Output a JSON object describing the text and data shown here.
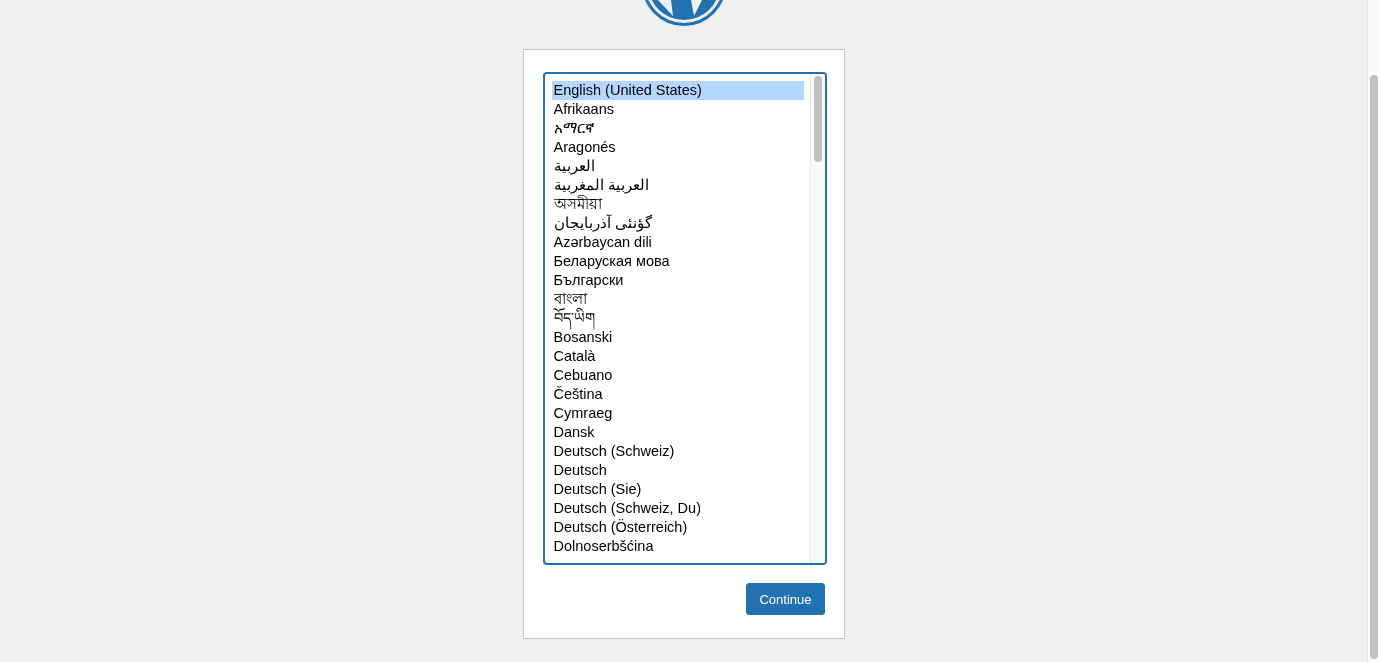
{
  "languages": [
    {
      "label": "English (United States)",
      "selected": true
    },
    {
      "label": "Afrikaans",
      "selected": false
    },
    {
      "label": "አማርኛ",
      "selected": false
    },
    {
      "label": "Aragonés",
      "selected": false
    },
    {
      "label": "العربية",
      "selected": false
    },
    {
      "label": "العربية المغربية",
      "selected": false
    },
    {
      "label": "অসমীয়া",
      "selected": false
    },
    {
      "label": "گؤنئی آذربایجان",
      "selected": false
    },
    {
      "label": "Azərbaycan dili",
      "selected": false
    },
    {
      "label": "Беларуская мова",
      "selected": false
    },
    {
      "label": "Български",
      "selected": false
    },
    {
      "label": "বাংলা",
      "selected": false
    },
    {
      "label": "བོད་ཡིག",
      "selected": false
    },
    {
      "label": "Bosanski",
      "selected": false
    },
    {
      "label": "Català",
      "selected": false
    },
    {
      "label": "Cebuano",
      "selected": false
    },
    {
      "label": "Čeština",
      "selected": false
    },
    {
      "label": "Cymraeg",
      "selected": false
    },
    {
      "label": "Dansk",
      "selected": false
    },
    {
      "label": "Deutsch (Schweiz)",
      "selected": false
    },
    {
      "label": "Deutsch",
      "selected": false
    },
    {
      "label": "Deutsch (Sie)",
      "selected": false
    },
    {
      "label": "Deutsch (Schweiz, Du)",
      "selected": false
    },
    {
      "label": "Deutsch (Österreich)",
      "selected": false
    },
    {
      "label": "Dolnoserbšćina",
      "selected": false
    }
  ],
  "continue_button": {
    "label": "Continue"
  }
}
